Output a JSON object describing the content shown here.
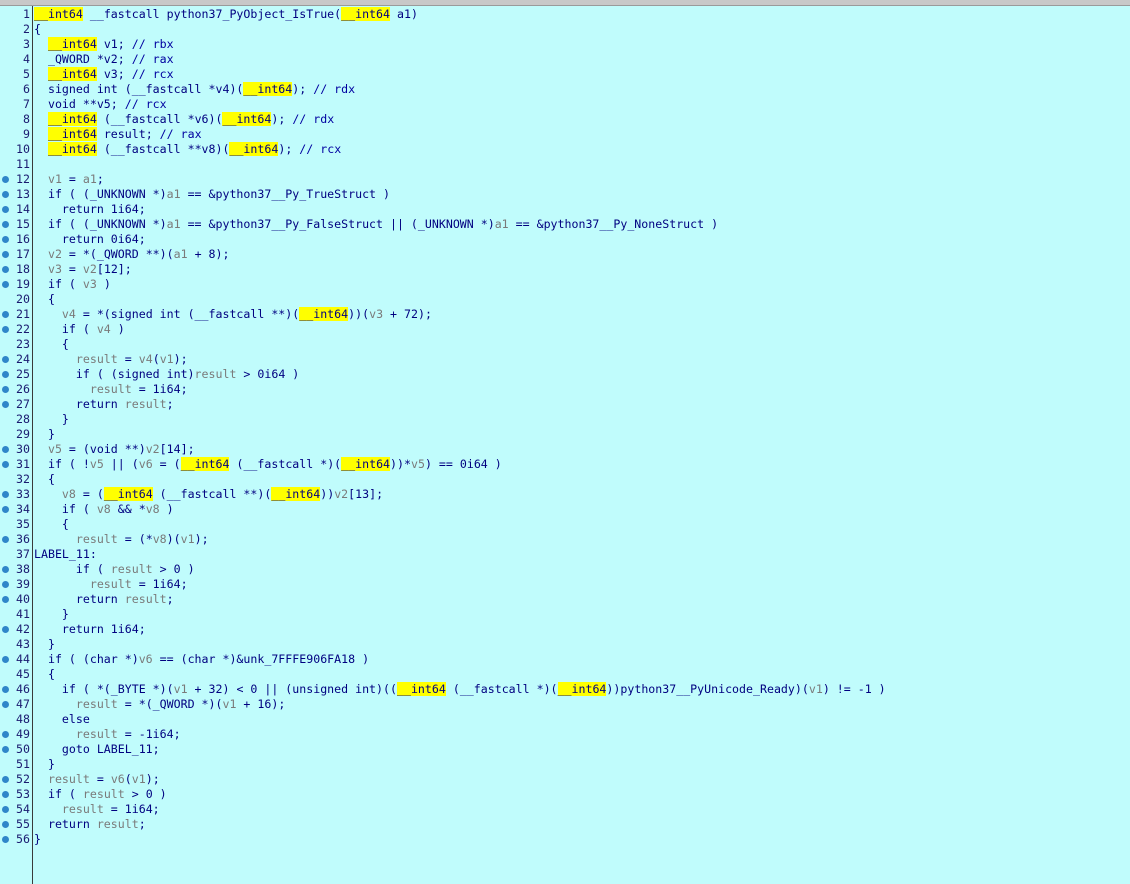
{
  "editor": {
    "background": "#c0fcfc",
    "highlight_color": "#ffff00",
    "breakpoint_color": "#2f86c9"
  },
  "lines": [
    {
      "n": "1",
      "bp": false,
      "t": [
        [
          "hl",
          "__int64"
        ],
        [
          "ty",
          " __fastcall python37_PyObject_IsTrue("
        ],
        [
          "hl",
          "__int64"
        ],
        [
          "ty",
          " a1)"
        ]
      ]
    },
    {
      "n": "2",
      "bp": false,
      "t": [
        [
          "ty",
          "{"
        ]
      ]
    },
    {
      "n": "3",
      "bp": false,
      "t": [
        [
          "ty",
          "  "
        ],
        [
          "hl",
          "__int64"
        ],
        [
          "ty",
          " v1; "
        ],
        [
          "cm",
          "// rbx"
        ]
      ]
    },
    {
      "n": "4",
      "bp": false,
      "t": [
        [
          "ty",
          "  _QWORD *v2; "
        ],
        [
          "cm",
          "// rax"
        ]
      ]
    },
    {
      "n": "5",
      "bp": false,
      "t": [
        [
          "ty",
          "  "
        ],
        [
          "hl",
          "__int64"
        ],
        [
          "ty",
          " v3; "
        ],
        [
          "cm",
          "// rcx"
        ]
      ]
    },
    {
      "n": "6",
      "bp": false,
      "t": [
        [
          "ty",
          "  signed int (__fastcall *v4)("
        ],
        [
          "hl",
          "__int64"
        ],
        [
          "ty",
          "); "
        ],
        [
          "cm",
          "// rdx"
        ]
      ]
    },
    {
      "n": "7",
      "bp": false,
      "t": [
        [
          "ty",
          "  void **v5; "
        ],
        [
          "cm",
          "// rcx"
        ]
      ]
    },
    {
      "n": "8",
      "bp": false,
      "t": [
        [
          "ty",
          "  "
        ],
        [
          "hl",
          "__int64"
        ],
        [
          "ty",
          " (__fastcall *v6)("
        ],
        [
          "hl",
          "__int64"
        ],
        [
          "ty",
          "); "
        ],
        [
          "cm",
          "// rdx"
        ]
      ]
    },
    {
      "n": "9",
      "bp": false,
      "t": [
        [
          "ty",
          "  "
        ],
        [
          "hl",
          "__int64"
        ],
        [
          "ty",
          " result; "
        ],
        [
          "cm",
          "// rax"
        ]
      ]
    },
    {
      "n": "10",
      "bp": false,
      "t": [
        [
          "ty",
          "  "
        ],
        [
          "hl",
          "__int64"
        ],
        [
          "ty",
          " (__fastcall **v8)("
        ],
        [
          "hl",
          "__int64"
        ],
        [
          "ty",
          "); "
        ],
        [
          "cm",
          "// rcx"
        ]
      ]
    },
    {
      "n": "11",
      "bp": false,
      "t": []
    },
    {
      "n": "12",
      "bp": true,
      "t": [
        [
          "ty",
          "  "
        ],
        [
          "vr",
          "v1"
        ],
        [
          "ty",
          " = "
        ],
        [
          "vr",
          "a1"
        ],
        [
          "ty",
          ";"
        ]
      ]
    },
    {
      "n": "13",
      "bp": true,
      "t": [
        [
          "ty",
          "  if ( (_UNKNOWN *)"
        ],
        [
          "vr",
          "a1"
        ],
        [
          "ty",
          " == &python37__Py_TrueStruct )"
        ]
      ]
    },
    {
      "n": "14",
      "bp": true,
      "t": [
        [
          "ty",
          "    return 1i64;"
        ]
      ]
    },
    {
      "n": "15",
      "bp": true,
      "t": [
        [
          "ty",
          "  if ( (_UNKNOWN *)"
        ],
        [
          "vr",
          "a1"
        ],
        [
          "ty",
          " == &python37__Py_FalseStruct || (_UNKNOWN *)"
        ],
        [
          "vr",
          "a1"
        ],
        [
          "ty",
          " == &python37__Py_NoneStruct )"
        ]
      ]
    },
    {
      "n": "16",
      "bp": true,
      "t": [
        [
          "ty",
          "    return 0i64;"
        ]
      ]
    },
    {
      "n": "17",
      "bp": true,
      "t": [
        [
          "ty",
          "  "
        ],
        [
          "vr",
          "v2"
        ],
        [
          "ty",
          " = *(_QWORD **)("
        ],
        [
          "vr",
          "a1"
        ],
        [
          "ty",
          " + 8);"
        ]
      ]
    },
    {
      "n": "18",
      "bp": true,
      "t": [
        [
          "ty",
          "  "
        ],
        [
          "vr",
          "v3"
        ],
        [
          "ty",
          " = "
        ],
        [
          "vr",
          "v2"
        ],
        [
          "ty",
          "[12];"
        ]
      ]
    },
    {
      "n": "19",
      "bp": true,
      "t": [
        [
          "ty",
          "  if ( "
        ],
        [
          "vr",
          "v3"
        ],
        [
          "ty",
          " )"
        ]
      ]
    },
    {
      "n": "20",
      "bp": false,
      "t": [
        [
          "ty",
          "  {"
        ]
      ]
    },
    {
      "n": "21",
      "bp": true,
      "t": [
        [
          "ty",
          "    "
        ],
        [
          "vr",
          "v4"
        ],
        [
          "ty",
          " = *(signed int (__fastcall **)("
        ],
        [
          "hl",
          "__int64"
        ],
        [
          "ty",
          "))("
        ],
        [
          "vr",
          "v3"
        ],
        [
          "ty",
          " + 72);"
        ]
      ]
    },
    {
      "n": "22",
      "bp": true,
      "t": [
        [
          "ty",
          "    if ( "
        ],
        [
          "vr",
          "v4"
        ],
        [
          "ty",
          " )"
        ]
      ]
    },
    {
      "n": "23",
      "bp": false,
      "t": [
        [
          "ty",
          "    {"
        ]
      ]
    },
    {
      "n": "24",
      "bp": true,
      "t": [
        [
          "ty",
          "      "
        ],
        [
          "vr",
          "result"
        ],
        [
          "ty",
          " = "
        ],
        [
          "vr",
          "v4"
        ],
        [
          "ty",
          "("
        ],
        [
          "vr",
          "v1"
        ],
        [
          "ty",
          ");"
        ]
      ]
    },
    {
      "n": "25",
      "bp": true,
      "t": [
        [
          "ty",
          "      if ( (signed int)"
        ],
        [
          "vr",
          "result"
        ],
        [
          "ty",
          " > 0i64 )"
        ]
      ]
    },
    {
      "n": "26",
      "bp": true,
      "t": [
        [
          "ty",
          "        "
        ],
        [
          "vr",
          "result"
        ],
        [
          "ty",
          " = 1i64;"
        ]
      ]
    },
    {
      "n": "27",
      "bp": true,
      "t": [
        [
          "ty",
          "      return "
        ],
        [
          "vr",
          "result"
        ],
        [
          "ty",
          ";"
        ]
      ]
    },
    {
      "n": "28",
      "bp": false,
      "t": [
        [
          "ty",
          "    }"
        ]
      ]
    },
    {
      "n": "29",
      "bp": false,
      "t": [
        [
          "ty",
          "  }"
        ]
      ]
    },
    {
      "n": "30",
      "bp": true,
      "t": [
        [
          "ty",
          "  "
        ],
        [
          "vr",
          "v5"
        ],
        [
          "ty",
          " = (void **)"
        ],
        [
          "vr",
          "v2"
        ],
        [
          "ty",
          "[14];"
        ]
      ]
    },
    {
      "n": "31",
      "bp": true,
      "t": [
        [
          "ty",
          "  if ( !"
        ],
        [
          "vr",
          "v5"
        ],
        [
          "ty",
          " || ("
        ],
        [
          "vr",
          "v6"
        ],
        [
          "ty",
          " = ("
        ],
        [
          "hl",
          "__int64"
        ],
        [
          "ty",
          " (__fastcall *)("
        ],
        [
          "hl",
          "__int64"
        ],
        [
          "ty",
          "))*"
        ],
        [
          "vr",
          "v5"
        ],
        [
          "ty",
          ") == 0i64 )"
        ]
      ]
    },
    {
      "n": "32",
      "bp": false,
      "t": [
        [
          "ty",
          "  {"
        ]
      ]
    },
    {
      "n": "33",
      "bp": true,
      "t": [
        [
          "ty",
          "    "
        ],
        [
          "vr",
          "v8"
        ],
        [
          "ty",
          " = ("
        ],
        [
          "hl",
          "__int64"
        ],
        [
          "ty",
          " (__fastcall **)("
        ],
        [
          "hl",
          "__int64"
        ],
        [
          "ty",
          "))"
        ],
        [
          "vr",
          "v2"
        ],
        [
          "ty",
          "[13];"
        ]
      ]
    },
    {
      "n": "34",
      "bp": true,
      "t": [
        [
          "ty",
          "    if ( "
        ],
        [
          "vr",
          "v8"
        ],
        [
          "ty",
          " && *"
        ],
        [
          "vr",
          "v8"
        ],
        [
          "ty",
          " )"
        ]
      ]
    },
    {
      "n": "35",
      "bp": false,
      "t": [
        [
          "ty",
          "    {"
        ]
      ]
    },
    {
      "n": "36",
      "bp": true,
      "t": [
        [
          "ty",
          "      "
        ],
        [
          "vr",
          "result"
        ],
        [
          "ty",
          " = (*"
        ],
        [
          "vr",
          "v8"
        ],
        [
          "ty",
          ")("
        ],
        [
          "vr",
          "v1"
        ],
        [
          "ty",
          ");"
        ]
      ]
    },
    {
      "n": "37",
      "bp": false,
      "t": [
        [
          "ty",
          "LABEL_11:"
        ]
      ]
    },
    {
      "n": "38",
      "bp": true,
      "t": [
        [
          "ty",
          "      if ( "
        ],
        [
          "vr",
          "result"
        ],
        [
          "ty",
          " > 0 )"
        ]
      ]
    },
    {
      "n": "39",
      "bp": true,
      "t": [
        [
          "ty",
          "        "
        ],
        [
          "vr",
          "result"
        ],
        [
          "ty",
          " = 1i64;"
        ]
      ]
    },
    {
      "n": "40",
      "bp": true,
      "t": [
        [
          "ty",
          "      return "
        ],
        [
          "vr",
          "result"
        ],
        [
          "ty",
          ";"
        ]
      ]
    },
    {
      "n": "41",
      "bp": false,
      "t": [
        [
          "ty",
          "    }"
        ]
      ]
    },
    {
      "n": "42",
      "bp": true,
      "t": [
        [
          "ty",
          "    return 1i64;"
        ]
      ]
    },
    {
      "n": "43",
      "bp": false,
      "t": [
        [
          "ty",
          "  }"
        ]
      ]
    },
    {
      "n": "44",
      "bp": true,
      "t": [
        [
          "ty",
          "  if ( (char *)"
        ],
        [
          "vr",
          "v6"
        ],
        [
          "ty",
          " == (char *)&unk_7FFFE906FA18 )"
        ]
      ]
    },
    {
      "n": "45",
      "bp": false,
      "t": [
        [
          "ty",
          "  {"
        ]
      ]
    },
    {
      "n": "46",
      "bp": true,
      "t": [
        [
          "ty",
          "    if ( *(_BYTE *)("
        ],
        [
          "vr",
          "v1"
        ],
        [
          "ty",
          " + 32) < 0 || (unsigned int)(("
        ],
        [
          "hl",
          "__int64"
        ],
        [
          "ty",
          " (__fastcall *)("
        ],
        [
          "hl",
          "__int64"
        ],
        [
          "ty",
          "))python37__PyUnicode_Ready)("
        ],
        [
          "vr",
          "v1"
        ],
        [
          "ty",
          ") != -1 )"
        ]
      ]
    },
    {
      "n": "47",
      "bp": true,
      "t": [
        [
          "ty",
          "      "
        ],
        [
          "vr",
          "result"
        ],
        [
          "ty",
          " = *(_QWORD *)("
        ],
        [
          "vr",
          "v1"
        ],
        [
          "ty",
          " + 16);"
        ]
      ]
    },
    {
      "n": "48",
      "bp": false,
      "t": [
        [
          "ty",
          "    else"
        ]
      ]
    },
    {
      "n": "49",
      "bp": true,
      "t": [
        [
          "ty",
          "      "
        ],
        [
          "vr",
          "result"
        ],
        [
          "ty",
          " = -1i64;"
        ]
      ]
    },
    {
      "n": "50",
      "bp": true,
      "t": [
        [
          "ty",
          "    goto LABEL_11;"
        ]
      ]
    },
    {
      "n": "51",
      "bp": false,
      "t": [
        [
          "ty",
          "  }"
        ]
      ]
    },
    {
      "n": "52",
      "bp": true,
      "t": [
        [
          "ty",
          "  "
        ],
        [
          "vr",
          "result"
        ],
        [
          "ty",
          " = "
        ],
        [
          "vr",
          "v6"
        ],
        [
          "ty",
          "("
        ],
        [
          "vr",
          "v1"
        ],
        [
          "ty",
          ");"
        ]
      ]
    },
    {
      "n": "53",
      "bp": true,
      "t": [
        [
          "ty",
          "  if ( "
        ],
        [
          "vr",
          "result"
        ],
        [
          "ty",
          " > 0 )"
        ]
      ]
    },
    {
      "n": "54",
      "bp": true,
      "t": [
        [
          "ty",
          "    "
        ],
        [
          "vr",
          "result"
        ],
        [
          "ty",
          " = 1i64;"
        ]
      ]
    },
    {
      "n": "55",
      "bp": true,
      "t": [
        [
          "ty",
          "  return "
        ],
        [
          "vr",
          "result"
        ],
        [
          "ty",
          ";"
        ]
      ]
    },
    {
      "n": "56",
      "bp": true,
      "t": [
        [
          "ty",
          "}"
        ]
      ]
    }
  ]
}
